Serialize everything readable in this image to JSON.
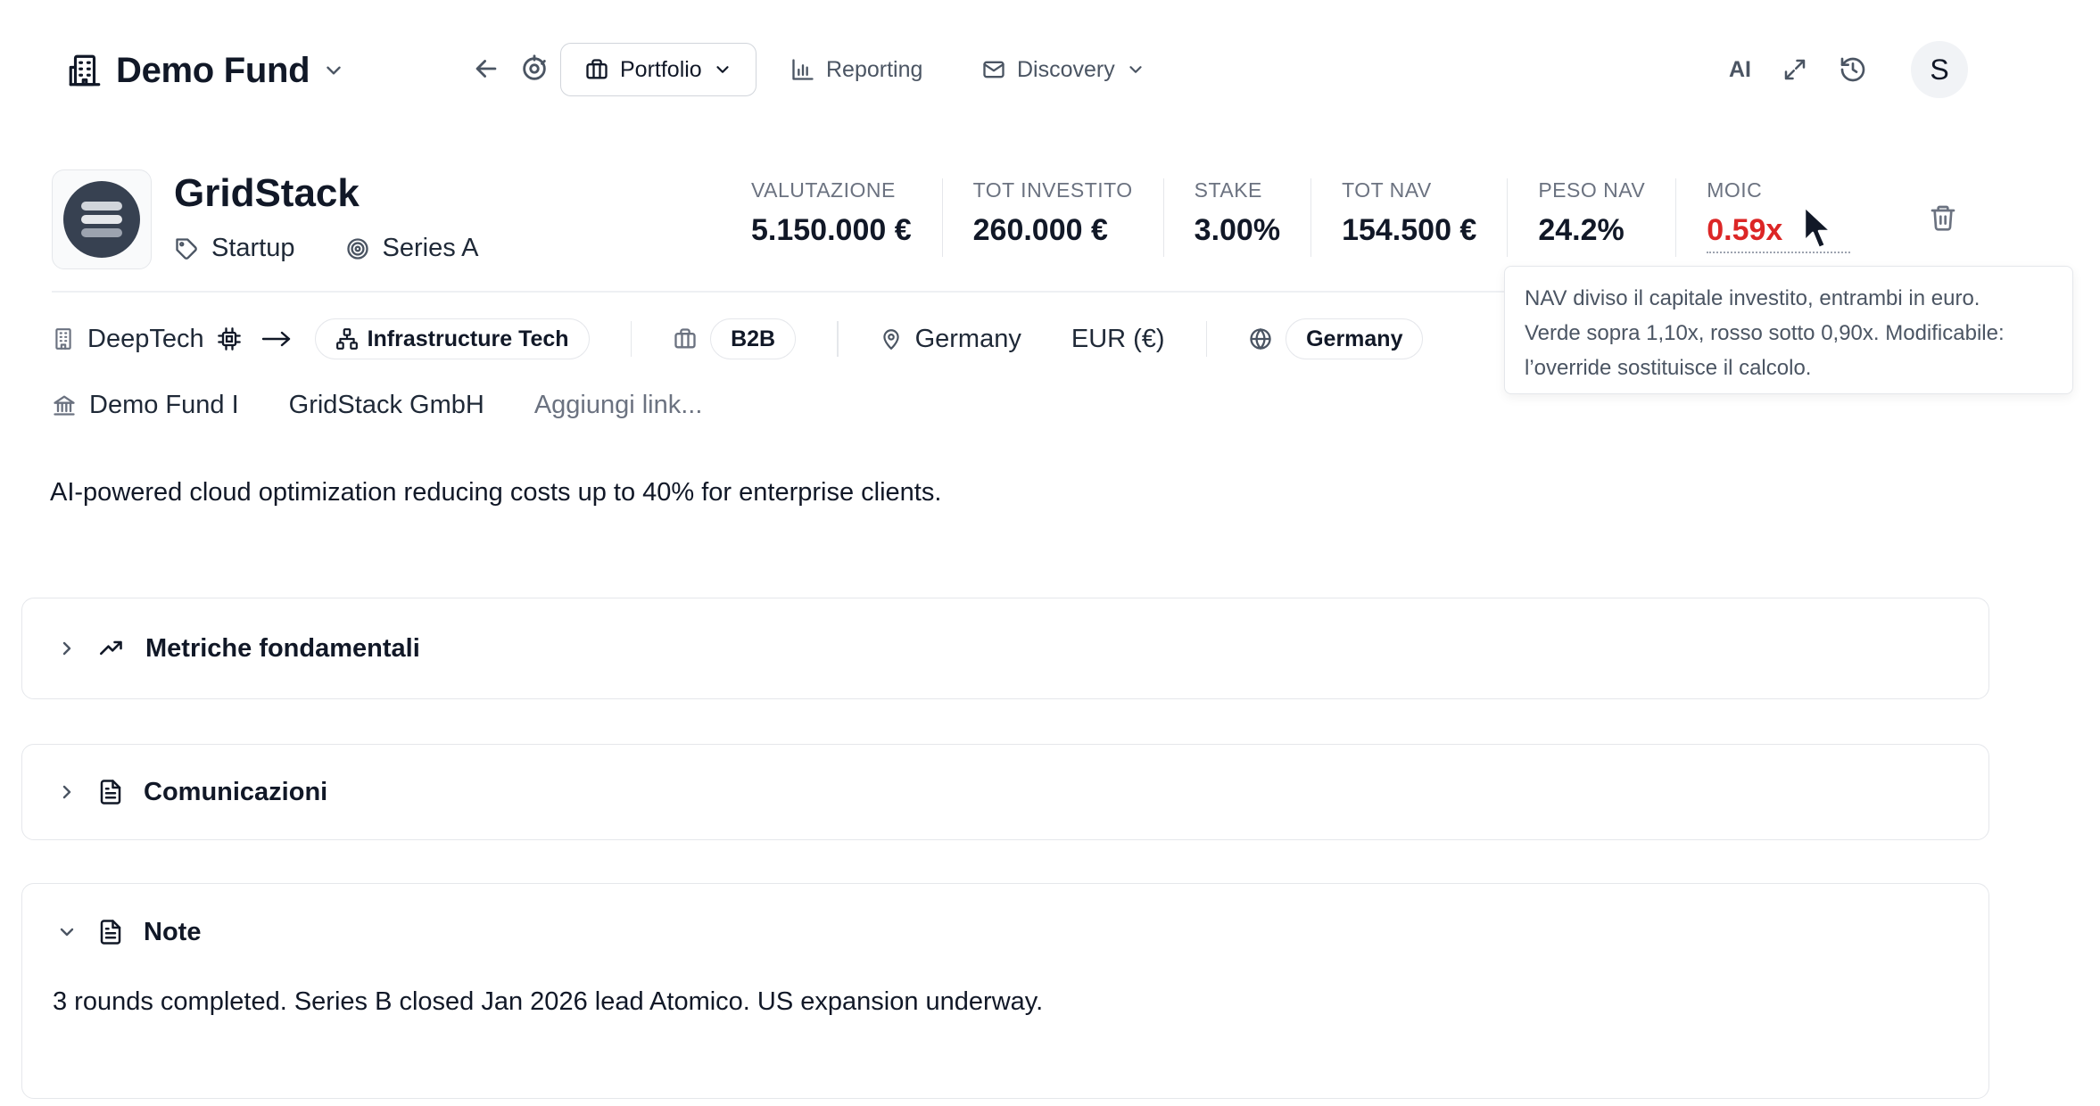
{
  "header": {
    "fund_name": "Demo Fund",
    "nav": {
      "portfolio": "Portfolio",
      "reporting": "Reporting",
      "discovery": "Discovery"
    },
    "ai_label": "AI",
    "avatar_initial": "S"
  },
  "company": {
    "name": "GridStack",
    "type": "Startup",
    "stage": "Series A",
    "metrics": [
      {
        "label": "VALUTAZIONE",
        "value": "5.150.000 €"
      },
      {
        "label": "TOT INVESTITO",
        "value": "260.000 €"
      },
      {
        "label": "STAKE",
        "value": "3.00%"
      },
      {
        "label": "TOT NAV",
        "value": "154.500 €"
      },
      {
        "label": "PESO NAV",
        "value": "24.2%"
      },
      {
        "label": "MOIC",
        "value": "0.59x"
      }
    ],
    "moic_color": "#dc2626"
  },
  "meta": {
    "sector": "DeepTech",
    "subsector": "Infrastructure Tech",
    "model": "B2B",
    "location": "Germany",
    "currency": "EUR (€)",
    "market": "Germany"
  },
  "links": {
    "fund": "Demo Fund I",
    "entity": "GridStack GmbH",
    "add_link": "Aggiungi link..."
  },
  "description": "AI-powered cloud optimization reducing costs up to 40% for enterprise clients.",
  "tooltip": {
    "line1": "NAV diviso il capitale investito, entrambi in euro.",
    "line2": "Verde sopra 1,10x, rosso sotto 0,90x. Modificabile:",
    "line3": "l’override sostituisce il calcolo."
  },
  "sections": {
    "metrics": {
      "title": "Metriche fondamentali"
    },
    "communications": {
      "title": "Comunicazioni"
    },
    "notes": {
      "title": "Note",
      "text": "3 rounds completed. Series B closed Jan 2026 lead Atomico. US expansion underway."
    }
  }
}
